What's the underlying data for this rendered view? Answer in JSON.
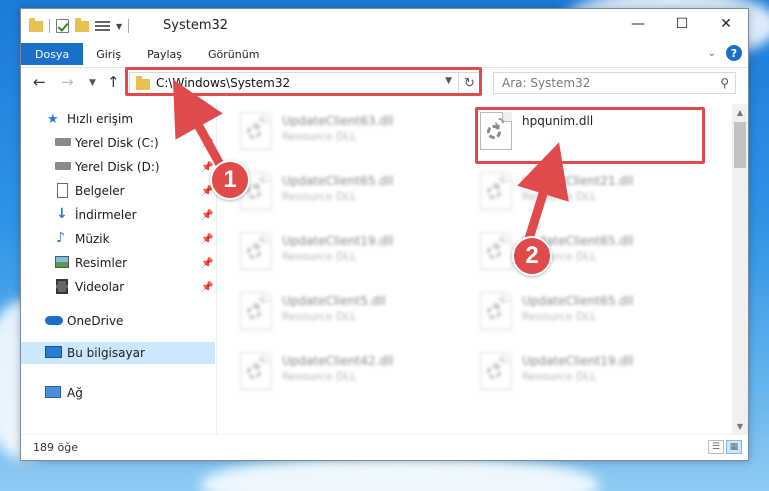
{
  "window": {
    "title": "System32"
  },
  "ribbon": {
    "tabs": [
      {
        "label": "Dosya"
      },
      {
        "label": "Giriş"
      },
      {
        "label": "Paylaş"
      },
      {
        "label": "Görünüm"
      }
    ]
  },
  "address": {
    "path": "C:\\Windows\\System32"
  },
  "search": {
    "placeholder": "Ara: System32"
  },
  "nav": {
    "quick_access": "Hızlı erişim",
    "items": [
      {
        "label": "Yerel Disk (C:)",
        "icon": "drive-icon"
      },
      {
        "label": "Yerel Disk (D:)",
        "icon": "drive-icon"
      },
      {
        "label": "Belgeler",
        "icon": "documents-icon"
      },
      {
        "label": "İndirmeler",
        "icon": "downloads-icon"
      },
      {
        "label": "Müzik",
        "icon": "music-icon"
      },
      {
        "label": "Resimler",
        "icon": "pictures-icon"
      },
      {
        "label": "Videolar",
        "icon": "videos-icon"
      }
    ],
    "onedrive": "OneDrive",
    "this_pc": "Bu bilgisayar",
    "network": "Ağ"
  },
  "files": {
    "highlighted": {
      "name": "hpqunim.dll",
      "type": ""
    },
    "left_column": [
      {
        "name": "UpdateClient63.dll",
        "type": "Resource DLL"
      },
      {
        "name": "UpdateClient65.dll",
        "type": "Resource DLL"
      },
      {
        "name": "UpdateClient19.dll",
        "type": "Resource DLL"
      },
      {
        "name": "UpdateClient5.dll",
        "type": "Resource DLL"
      },
      {
        "name": "UpdateClient42.dll",
        "type": "Resource DLL"
      }
    ],
    "right_column": [
      {
        "name": "UpdateClient21.dll",
        "type": "Resource DLL"
      },
      {
        "name": "UpdateClient65.dll",
        "type": "Resource DLL"
      },
      {
        "name": "UpdateClient65.dll",
        "type": "Resource DLL"
      },
      {
        "name": "UpdateClient19.dll",
        "type": "Resource DLL"
      }
    ]
  },
  "status": {
    "item_count": "189 öğe"
  },
  "annotations": {
    "step1": "1",
    "step2": "2",
    "color": "#e04a4a"
  }
}
